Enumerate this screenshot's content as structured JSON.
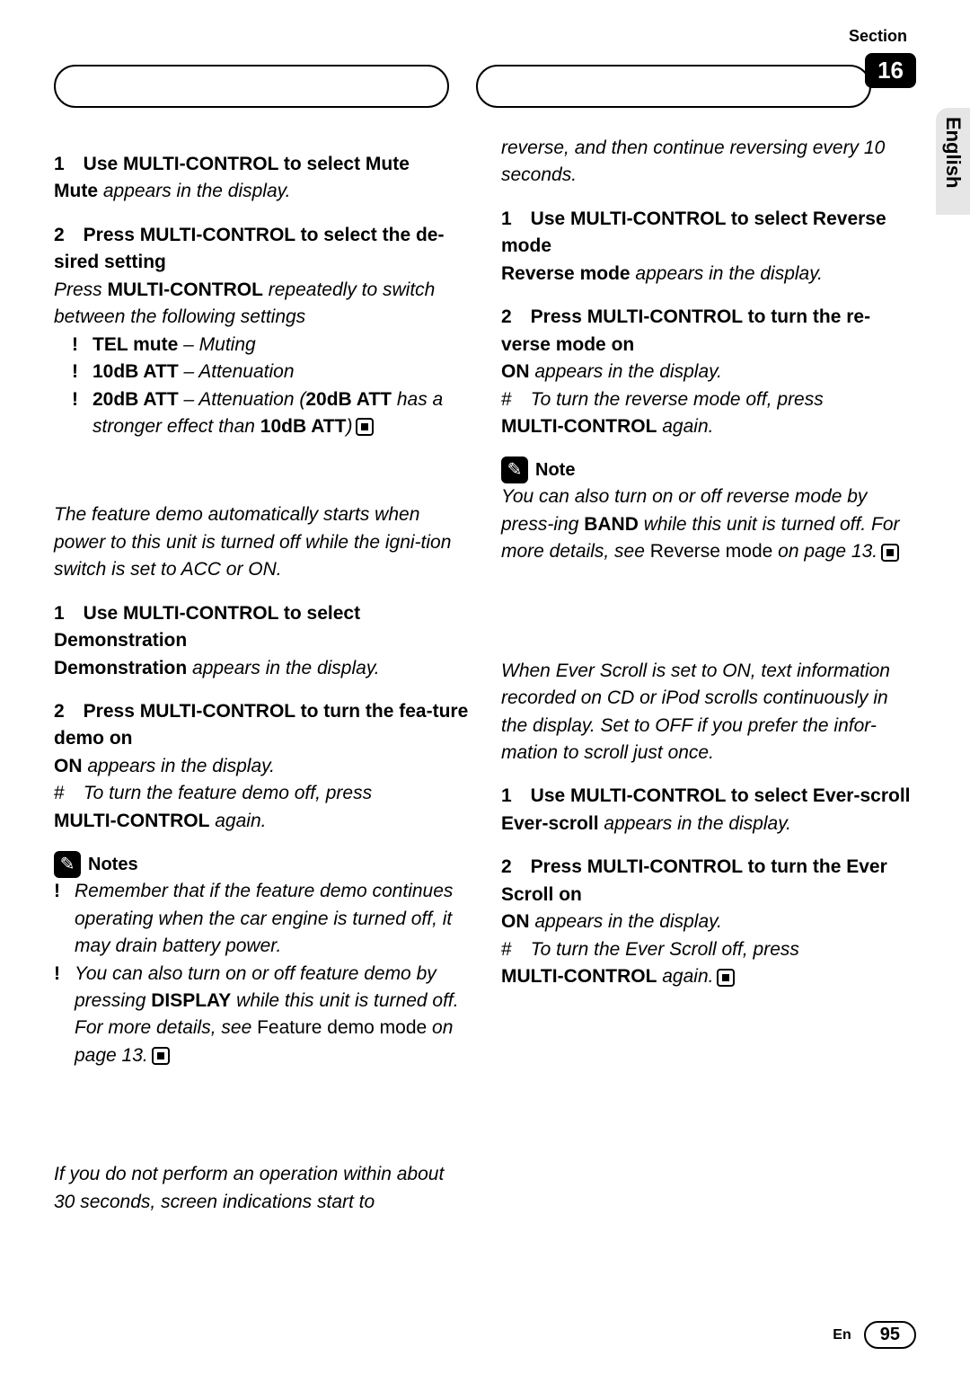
{
  "header": {
    "section_label": "Section",
    "section_number": "16",
    "language": "English"
  },
  "left": {
    "mute": {
      "h1": "1 Use MULTI-CONTROL to select Mute",
      "h1_sub_b": "Mute",
      "h1_sub_i": " appears in the display.",
      "h2": "2 Press MULTI-CONTROL to select the de-sired setting",
      "h2_sub_pre": "Press ",
      "h2_sub_b": "MULTI-CONTROL",
      "h2_sub_post": " repeatedly to switch between the following settings",
      "b1_b": "TEL mute",
      "b1_i": "– Muting",
      "b2_b": "10dB ATT",
      "b2_i": "– Attenuation",
      "b3_b": "20dB ATT",
      "b3_pre": "– Attenuation (",
      "b3_mid_b": "20dB ATT",
      "b3_mid_i": " has a stronger effect than ",
      "b3_end_b": "10dB ATT",
      "b3_close": ")"
    },
    "demo": {
      "intro": "The feature demo automatically starts when power to this unit is turned off while the igni-tion switch is set to ACC or ON.",
      "h1": "1 Use MULTI-CONTROL to select Demonstration",
      "h1_sub_b": "Demonstration",
      "h1_sub_i": " appears in the display.",
      "h2": "2 Press MULTI-CONTROL to turn the fea-ture demo on",
      "on_b": "ON",
      "on_i": " appears in the display.",
      "hash": "# ",
      "hash_i": "To turn the feature demo off, press",
      "mc_b": "MULTI-CONTROL",
      "mc_i": " again.",
      "notes_title": "Notes",
      "n1": "Remember that if the feature demo continues operating when the car engine is turned off, it may drain battery power.",
      "n2_pre": "You can also turn on or off feature demo by pressing ",
      "n2_b": "DISPLAY",
      "n2_mid": " while this unit is turned off. For more details, see ",
      "n2_link": "Feature demo mode",
      "n2_post": " on page 13."
    },
    "rev_intro": "If you do not perform an operation within about 30 seconds, screen indications start to"
  },
  "right": {
    "rev_cont": "reverse, and then continue reversing every 10 seconds.",
    "rev": {
      "h1": "1 Use MULTI-CONTROL to select Reverse mode",
      "h1_sub_b": "Reverse mode",
      "h1_sub_i": " appears in the display.",
      "h2": "2 Press MULTI-CONTROL to turn the re-verse mode on",
      "on_b": "ON",
      "on_i": " appears in the display.",
      "hash": "# ",
      "hash_i": "To turn the reverse mode off, press",
      "mc_b": "MULTI-CONTROL",
      "mc_i": " again.",
      "note_title": "Note",
      "note_pre": "You can also turn on or off reverse mode by press-ing ",
      "note_b": "BAND",
      "note_mid": " while this unit is turned off. For more details, see ",
      "note_link": "Reverse mode",
      "note_post": " on page 13."
    },
    "scroll": {
      "intro": "When Ever Scroll is set to ON, text information recorded on CD or iPod scrolls continuously in the display. Set to OFF if you prefer the infor-mation to scroll just once.",
      "h1": "1 Use MULTI-CONTROL to select Ever-scroll",
      "h1_sub_b": "Ever-scroll",
      "h1_sub_i": " appears in the display.",
      "h2": "2 Press MULTI-CONTROL to turn the Ever Scroll on",
      "on_b": "ON",
      "on_i": " appears in the display.",
      "hash": "# ",
      "hash_i": "To turn the Ever Scroll off, press",
      "mc_b": "MULTI-CONTROL",
      "mc_i": " again."
    }
  },
  "footer": {
    "lang": "En",
    "page": "95"
  }
}
